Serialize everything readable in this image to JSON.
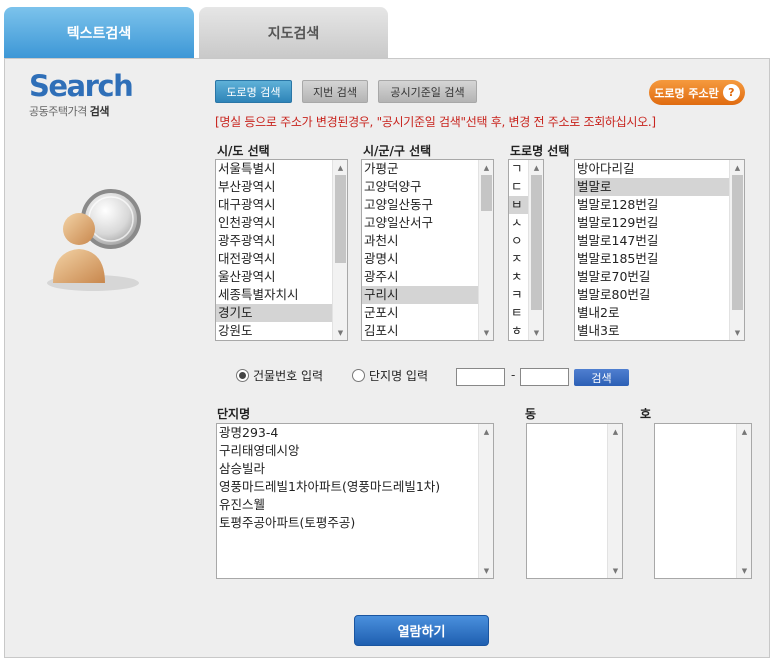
{
  "tabs": {
    "text_search": "텍스트검색",
    "map_search": "지도검색"
  },
  "logo": {
    "word": "Search",
    "sub_prefix": "공동주택가격",
    "sub_bold": "검색"
  },
  "modes": {
    "road": "도로명 검색",
    "lot": "지번 검색",
    "date": "공시기준일 검색",
    "guide": "도로명 주소란",
    "guide_icon": "?"
  },
  "notice": "[명실 등으로 주소가 변경된경우, \"공시기준일 검색\"선택 후, 변경 전 주소로 조회하십시오.]",
  "labels": {
    "sido": "시/도 선택",
    "sigungu": "시/군/구 선택",
    "road": "도로명 선택",
    "complex": "단지명",
    "dong": "동",
    "ho": "호"
  },
  "sido": [
    "서울특별시",
    "부산광역시",
    "대구광역시",
    "인천광역시",
    "광주광역시",
    "대전광역시",
    "울산광역시",
    "세종특별자치시",
    "경기도",
    "강원도"
  ],
  "sido_selected": 8,
  "sigungu": [
    "가평군",
    "고양덕양구",
    "고양일산동구",
    "고양일산서구",
    "과천시",
    "광명시",
    "광주시",
    "구리시",
    "군포시",
    "김포시"
  ],
  "sigungu_selected": 7,
  "initials": [
    "ㄱ",
    "ㄷ",
    "ㅂ",
    "ㅅ",
    "ㅇ",
    "ㅈ",
    "ㅊ",
    "ㅋ",
    "ㅌ",
    "ㅎ"
  ],
  "initials_selected": 2,
  "roads": [
    "방아다리길",
    "벌말로",
    "벌말로128번길",
    "벌말로129번길",
    "벌말로147번길",
    "벌말로185번길",
    "벌말로70번길",
    "벌말로80번길",
    "별내2로",
    "별내3로"
  ],
  "roads_selected": 1,
  "input_mode": {
    "building": "건물번호 입력",
    "complex": "단지명 입력"
  },
  "number_dash": "-",
  "search_button": "검색",
  "complexes": [
    "광명293-4",
    "구리태영데시앙",
    "삼승빌라",
    "영풍마드레빌1차아파트(영풍마드레빌1차)",
    "유진스웰",
    "토평주공아파트(토평주공)"
  ],
  "view_button": "열람하기",
  "colors": {
    "active_tab": "#3d97d6",
    "notice": "#c8241e",
    "guide_button": "#e06b10",
    "view_button": "#1f5fb0"
  },
  "icons": {
    "user_search": "user-with-magnifier",
    "scroll_up": "triangle-up",
    "scroll_down": "triangle-down"
  }
}
